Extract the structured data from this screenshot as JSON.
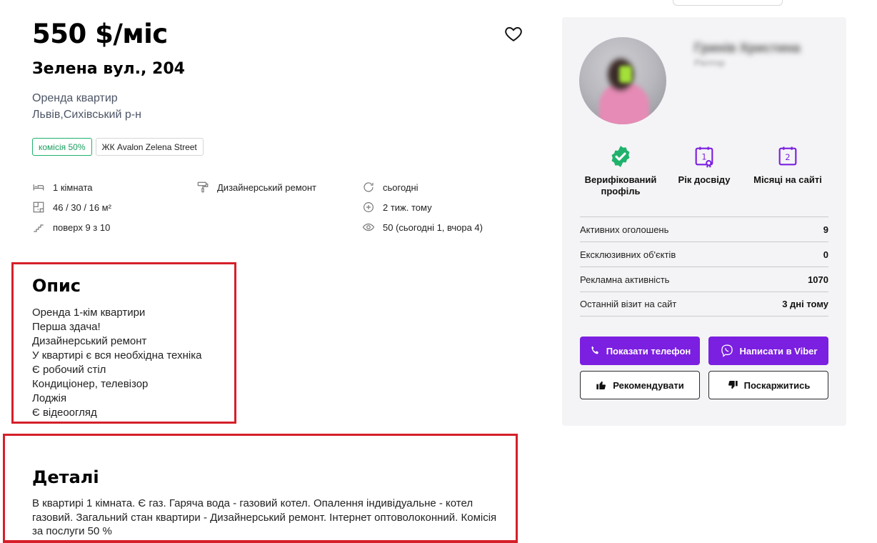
{
  "listing": {
    "price": "550 $/міс",
    "address": "Зелена вул., 204",
    "category": "Оренда квартир",
    "location": "Львів,Сихівський р-н",
    "tags": {
      "commission": "комісія 50%",
      "complex": "ЖК Avalon Zelena Street"
    },
    "features": {
      "rooms": "1 кімната",
      "area": "46 / 30 / 16 м²",
      "floor": "поверх 9 з 10",
      "renovation": "Дизайнерський ремонт",
      "updated": "сьогодні",
      "published": "2 тиж. тому",
      "views": "50 (сьогодні 1, вчора 4)"
    }
  },
  "description": {
    "title": "Опис",
    "lines": [
      "Оренда 1-кім квартири",
      "Перша здача!",
      "Дизайнерський ремонт",
      "У квартирі є вся необхідна техніка",
      "Є робочий стіл",
      "Кондиціонер, телевізор",
      "Лоджія",
      "Є відеоогляд"
    ]
  },
  "details": {
    "title": "Деталі",
    "text": "В квартирі 1 кімната. Є газ. Гаряча вода - газовий котел. Опалення індивідуальне - котел газовий. Загальний стан квартири - Дизайнерський ремонт. Інтернет оптоволоконний. Комісія за послуги 50 %"
  },
  "agent": {
    "name": "Гринів Христина",
    "role": "Ріелтор",
    "badges": {
      "verified": "Верифікований профіль",
      "experience": "Рік досвіду",
      "months": "Місяці на сайті",
      "experience_num": "1",
      "months_num": "2"
    },
    "stats": [
      {
        "label": "Активних оголошень",
        "value": "9"
      },
      {
        "label": "Ексклюзивних об'єктів",
        "value": "0"
      },
      {
        "label": "Рекламна активність",
        "value": "1070"
      },
      {
        "label": "Останній візит на сайт",
        "value": "3 дні тому"
      }
    ],
    "buttons": {
      "show_phone": "Показати телефон",
      "viber": "Написати в Viber",
      "recommend": "Рекомендувати",
      "complain": "Поскаржитись"
    }
  },
  "colors": {
    "accent_purple": "#7b1fe0",
    "verified_green": "#20b26c",
    "highlight_red": "#d5202a"
  }
}
